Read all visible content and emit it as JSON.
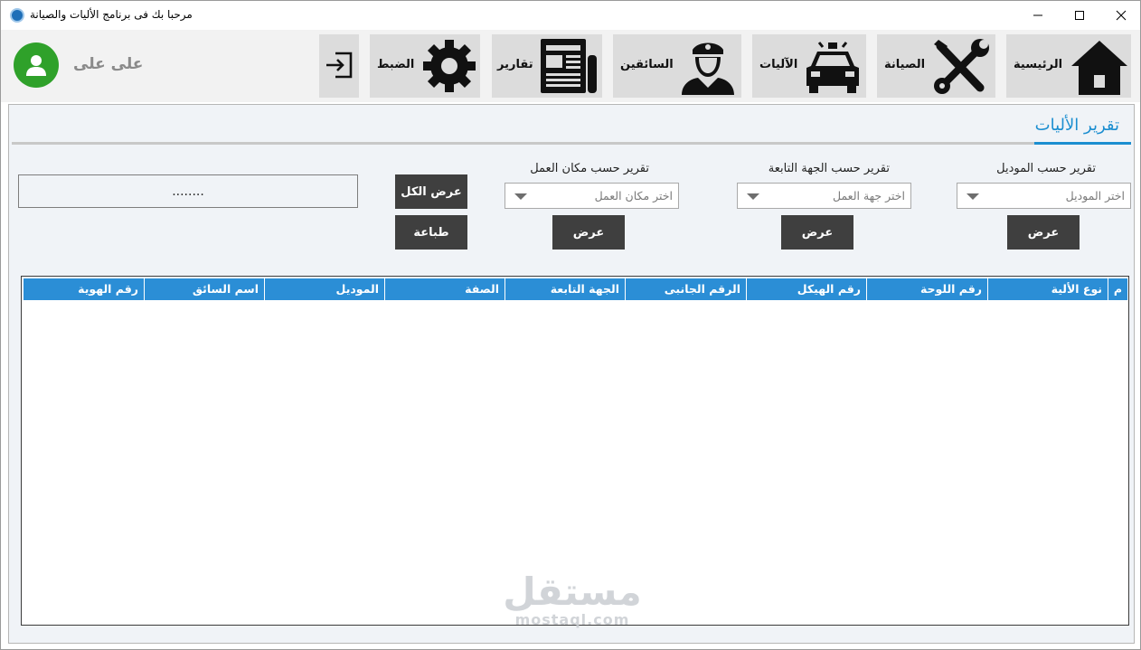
{
  "window": {
    "title": "مرحبا بك فى برنامج الأليات والصيانة",
    "icons": [
      "app-icon",
      "minimize-icon",
      "maximize-icon",
      "close-icon"
    ]
  },
  "user": {
    "name": "على على",
    "avatar_icon": "user-avatar-icon",
    "avatar_color": "#2fa12a"
  },
  "toolbar": {
    "home": {
      "label": "الرئيسية",
      "icon": "home-icon"
    },
    "maintenance": {
      "label": "الصيانة",
      "icon": "tools-icon"
    },
    "vehicles": {
      "label": "الآليات",
      "icon": "car-icon"
    },
    "drivers": {
      "label": "السائقين",
      "icon": "driver-icon"
    },
    "reports": {
      "label": "تقارير",
      "icon": "newspaper-icon"
    },
    "settings": {
      "label": "الضبط",
      "icon": "gear-icon"
    },
    "logout": {
      "icon": "logout-icon"
    }
  },
  "page": {
    "title": "تقرير الأليات",
    "accent_color": "#1b8ed0"
  },
  "filters": {
    "by_model": {
      "label": "تقرير حسب الموديل",
      "placeholder": "اختر الموديل",
      "button": "عرض"
    },
    "by_department": {
      "label": "تقرير حسب  الجهة التابعة",
      "placeholder": "اختر جهة العمل",
      "button": "عرض"
    },
    "by_workplace": {
      "label": "تقرير حسب مكان العمل",
      "placeholder": "اختر مكان العمل",
      "button": "عرض"
    },
    "show_all_button": "عرض الكل",
    "print_button": "طباعة",
    "search_value": "........"
  },
  "grid": {
    "header_color": "#2b8ed6",
    "columns": [
      "م",
      "نوع الألية",
      "رقم اللوحة",
      "رقم الهيكل",
      "الرقم الجانبى",
      "الجهة التابعة",
      "الصفة",
      "الموديل",
      "اسم السائق",
      "رقم الهوية"
    ],
    "rows": []
  },
  "watermark": {
    "arabic": "مستقل",
    "latin": "mostaql.com"
  }
}
